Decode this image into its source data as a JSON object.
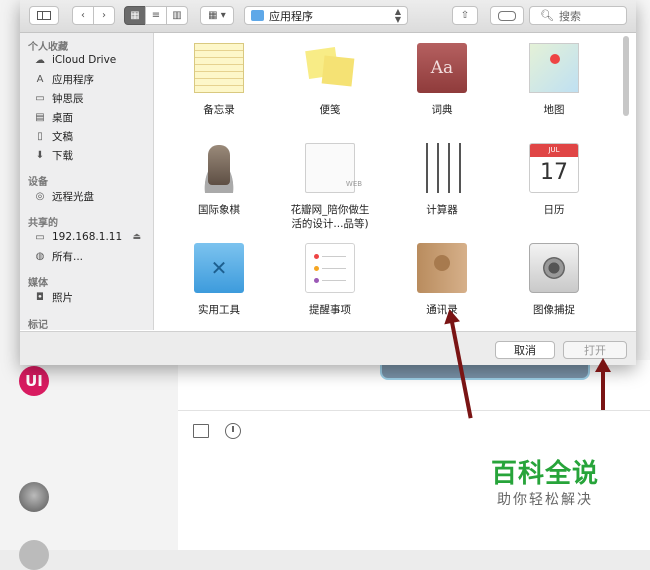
{
  "toolbar": {
    "location": "应用程序",
    "search_placeholder": "搜索"
  },
  "sidebar": {
    "favorites_header": "个人收藏",
    "favorites": [
      {
        "label": "iCloud Drive",
        "icon": "cloud-icon"
      },
      {
        "label": "应用程序",
        "icon": "applications-icon",
        "selected": true
      },
      {
        "label": "钟思辰",
        "icon": "home-icon"
      },
      {
        "label": "桌面",
        "icon": "desktop-icon"
      },
      {
        "label": "文稿",
        "icon": "documents-icon"
      },
      {
        "label": "下载",
        "icon": "download-icon"
      }
    ],
    "devices_header": "设备",
    "devices": [
      {
        "label": "远程光盘",
        "icon": "disc-icon"
      }
    ],
    "shared_header": "共享的",
    "shared": [
      {
        "label": "192.168.1.11",
        "icon": "computer-icon"
      },
      {
        "label": "所有...",
        "icon": "network-icon"
      }
    ],
    "media_header": "媒体",
    "media": [
      {
        "label": "照片",
        "icon": "camera-icon"
      }
    ],
    "tags_header": "标记"
  },
  "apps": [
    {
      "label": "备忘录",
      "icon": "notes-icon"
    },
    {
      "label": "便笺",
      "icon": "stickies-icon"
    },
    {
      "label": "词典",
      "icon": "dictionary-icon",
      "text": "Aa"
    },
    {
      "label": "地图",
      "icon": "maps-icon"
    },
    {
      "label": "国际象棋",
      "icon": "chess-icon"
    },
    {
      "label": "花瓣网_陪你做生活的设计...品等)",
      "label_line1": "花瓣网_陪你做生",
      "label_line2": "活的设计...品等)",
      "icon": "webloc-icon",
      "text": "WEB"
    },
    {
      "label": "计算器",
      "icon": "calculator-icon"
    },
    {
      "label": "日历",
      "icon": "calendar-icon",
      "month": "JUL",
      "day": "17"
    },
    {
      "label": "实用工具",
      "icon": "utilities-folder-icon"
    },
    {
      "label": "提醒事项",
      "icon": "reminders-icon"
    },
    {
      "label": "通讯录",
      "icon": "contacts-icon"
    },
    {
      "label": "图像捕捉",
      "icon": "image-capture-icon"
    }
  ],
  "footer": {
    "cancel_label": "取消",
    "open_label": "打开"
  },
  "background": {
    "avatar_initials": "UI"
  },
  "watermark": {
    "title": "百科全说",
    "subtitle": "助你轻松解决"
  },
  "colors": {
    "accent": "#5fa8e8",
    "watermark_green": "#27a43a",
    "arrow": "#7a1414"
  }
}
